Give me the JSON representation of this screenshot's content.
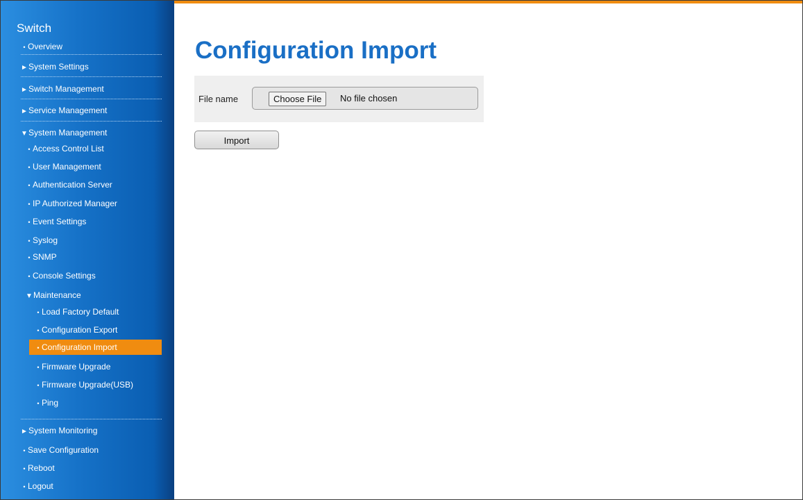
{
  "sidebar": {
    "title": "Switch",
    "items": [
      {
        "label": "Overview",
        "marker": "•"
      },
      {
        "label": "System Settings",
        "marker": "►"
      },
      {
        "label": "Switch Management",
        "marker": "►"
      },
      {
        "label": "Service Management",
        "marker": "►"
      },
      {
        "label": "System Management",
        "marker": "▼"
      },
      {
        "label": "Access Control List",
        "marker": "•"
      },
      {
        "label": "User Management",
        "marker": "•"
      },
      {
        "label": "Authentication Server",
        "marker": "•"
      },
      {
        "label": "IP Authorized Manager",
        "marker": "•"
      },
      {
        "label": "Event Settings",
        "marker": "•"
      },
      {
        "label": "Syslog",
        "marker": "•"
      },
      {
        "label": "SNMP",
        "marker": "•"
      },
      {
        "label": "Console Settings",
        "marker": "•"
      },
      {
        "label": "Maintenance",
        "marker": "▼"
      },
      {
        "label": "Load Factory Default",
        "marker": "•"
      },
      {
        "label": "Configuration Export",
        "marker": "•"
      },
      {
        "label": "Configuration Import",
        "marker": "•"
      },
      {
        "label": "Firmware Upgrade",
        "marker": "•"
      },
      {
        "label": "Firmware Upgrade(USB)",
        "marker": "•"
      },
      {
        "label": "Ping",
        "marker": "•"
      },
      {
        "label": "System Monitoring",
        "marker": "►"
      },
      {
        "label": "Save Configuration",
        "marker": "•"
      },
      {
        "label": "Reboot",
        "marker": "•"
      },
      {
        "label": "Logout",
        "marker": "•"
      }
    ]
  },
  "main": {
    "title": "Configuration Import",
    "file_label": "File name",
    "choose_file_button": "Choose File",
    "file_status": "No file chosen",
    "import_button": "Import"
  },
  "colors": {
    "accent": "#f08c10",
    "title": "#1a6fc5",
    "sidebar": "#1672c8"
  }
}
